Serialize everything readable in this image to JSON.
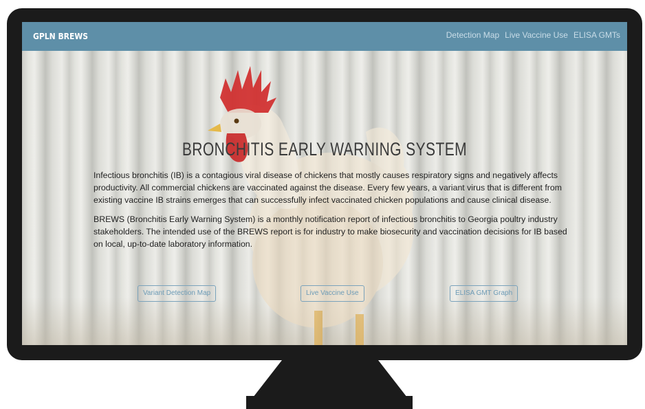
{
  "navbar": {
    "brand": "GPLN BREWS",
    "links": [
      "Detection Map",
      "Live Vaccine Use",
      "ELISA GMTs"
    ]
  },
  "hero": {
    "title": "BRONCHITIS EARLY WARNING SYSTEM",
    "paragraph1": "Infectious bronchitis (IB) is a contagious viral disease of chickens that mostly causes respiratory signs and negatively affects productivity. All commercial chickens are vaccinated against the disease. Every few years, a variant virus that is different from existing vaccine IB strains emerges that can successfully infect vaccinated chicken populations and cause clinical disease.",
    "paragraph2": "BREWS (Bronchitis Early Warning System) is a monthly notification report of infectious bronchitis to Georgia poultry industry stakeholders. The intended use of the BREWS report is for industry to make biosecurity and vaccination decisions for IB based on local, up-to-date laboratory information.",
    "buttons": [
      "Variant Detection Map",
      "Live Vaccine Use",
      "ELISA GMT Graph"
    ]
  },
  "colors": {
    "navbar": "#5e8fa8",
    "button_border": "#7aa2bb",
    "monitor": "#1b1b1b"
  }
}
